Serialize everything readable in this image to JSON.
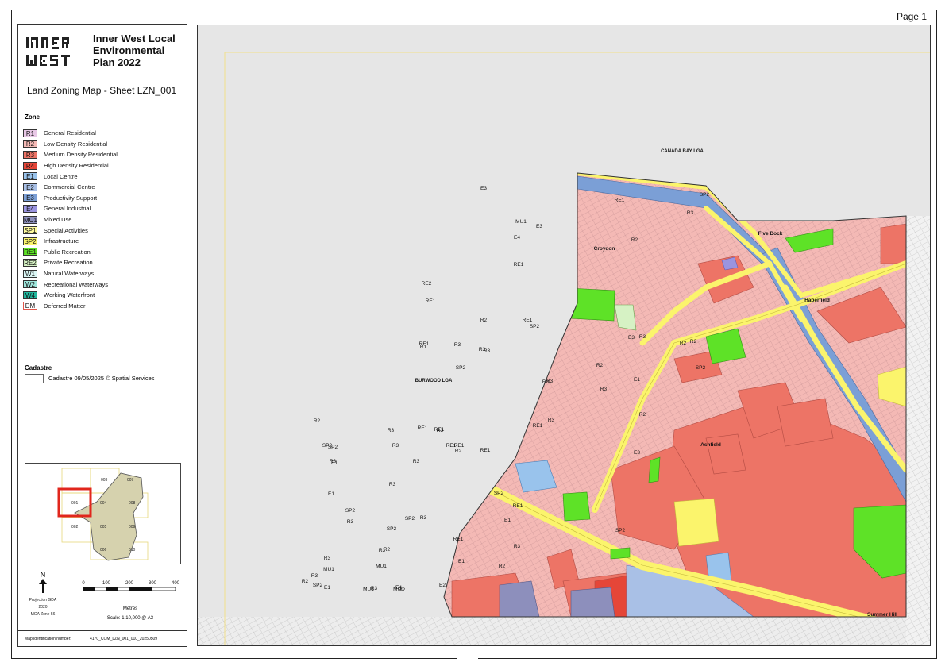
{
  "page": {
    "label": "Page 1"
  },
  "panel": {
    "plan_title": "Inner West Local Environmental Plan 2022",
    "logo_text_line1": "INNER",
    "logo_text_line2": "WEST",
    "sheet_title": "Land Zoning Map - Sheet LZN_001",
    "zone_heading": "Zone",
    "legend": [
      {
        "code": "R1",
        "label": "General Residential",
        "color": "#e8c8e6"
      },
      {
        "code": "R2",
        "label": "Low Density Residential",
        "color": "#f4b9b5"
      },
      {
        "code": "R3",
        "label": "Medium Density Residential",
        "color": "#ed7466"
      },
      {
        "code": "R4",
        "label": "High Density Residential",
        "color": "#e54638"
      },
      {
        "code": "E1",
        "label": "Local Centre",
        "color": "#99c3ec"
      },
      {
        "code": "E2",
        "label": "Commercial Centre",
        "color": "#a9c0e6"
      },
      {
        "code": "E3",
        "label": "Productivity Support",
        "color": "#7b9fd6"
      },
      {
        "code": "E4",
        "label": "General Industrial",
        "color": "#9a94e0"
      },
      {
        "code": "MU1",
        "label": "Mixed Use",
        "color": "#8d8fbc"
      },
      {
        "code": "SP1",
        "label": "Special Activities",
        "color": "#fffb9c"
      },
      {
        "code": "SP2",
        "label": "Infrastructure",
        "color": "#fbf46c"
      },
      {
        "code": "RE1",
        "label": "Public Recreation",
        "color": "#5ee227"
      },
      {
        "code": "RE2",
        "label": "Private Recreation",
        "color": "#d6f2c4"
      },
      {
        "code": "W1",
        "label": "Natural Waterways",
        "color": "#dbf7f5"
      },
      {
        "code": "W2",
        "label": "Recreational Waterways",
        "color": "#9fe7dd"
      },
      {
        "code": "W4",
        "label": "Working Waterfront",
        "color": "#21b79e"
      },
      {
        "code": "DM",
        "label": "Deferred Matter",
        "color": "#ffffff"
      }
    ],
    "cadastre_heading": "Cadastre",
    "cadastre_label": "Cadastre 09/05/2025 © Spatial Services",
    "keymap_sheets": [
      "001",
      "002",
      "003",
      "004",
      "005",
      "006",
      "007",
      "008",
      "009",
      "010"
    ],
    "north": "N",
    "projection_line1": "Projection GDA 2020",
    "projection_line2": "MGA Zone 56",
    "scale_ticks": [
      "0",
      "100",
      "200",
      "300",
      "400"
    ],
    "scale_units": "Metres",
    "scale_ratio": "Scale: 1:10,000 @ A3",
    "map_id_label": "Map identification number:",
    "map_id_value": "4170_COM_LZN_001_010_20250509"
  },
  "map": {
    "lga_canada_bay": "CANADA BAY LGA",
    "lga_burwood": "BURWOOD LGA",
    "localities": [
      "Croydon",
      "Five Dock",
      "Haberfield",
      "Ashfield",
      "Summer Hill"
    ],
    "zone_labels": [
      "E3",
      "RE1",
      "SP2",
      "R3",
      "R2",
      "MU1",
      "E4",
      "E3",
      "RE1",
      "RE2",
      "RE1",
      "R1",
      "R2",
      "RE1",
      "SP2",
      "R2",
      "R3",
      "R3",
      "R3",
      "E3",
      "R3",
      "R2",
      "SP2",
      "R3",
      "R3",
      "R2",
      "E1",
      "RE1",
      "SP2",
      "R3",
      "R3",
      "R3",
      "E3",
      "R2",
      "RE1",
      "RE1",
      "RE1",
      "R3",
      "RE1",
      "SP2",
      "R3",
      "R2",
      "R3",
      "SP2",
      "E1",
      "R3",
      "E1",
      "R2",
      "RE1",
      "RE1",
      "SP2",
      "R3",
      "R3",
      "SP2",
      "SP2",
      "R3",
      "RE1",
      "E1",
      "R3",
      "SP2",
      "R3",
      "R2",
      "RE1",
      "SP2",
      "E1",
      "R3",
      "R3",
      "E4",
      "MU1",
      "MU1",
      "R2",
      "E2",
      "R2",
      "MU1",
      "R3",
      "MU1",
      "R2",
      "SP2",
      "E1"
    ]
  }
}
